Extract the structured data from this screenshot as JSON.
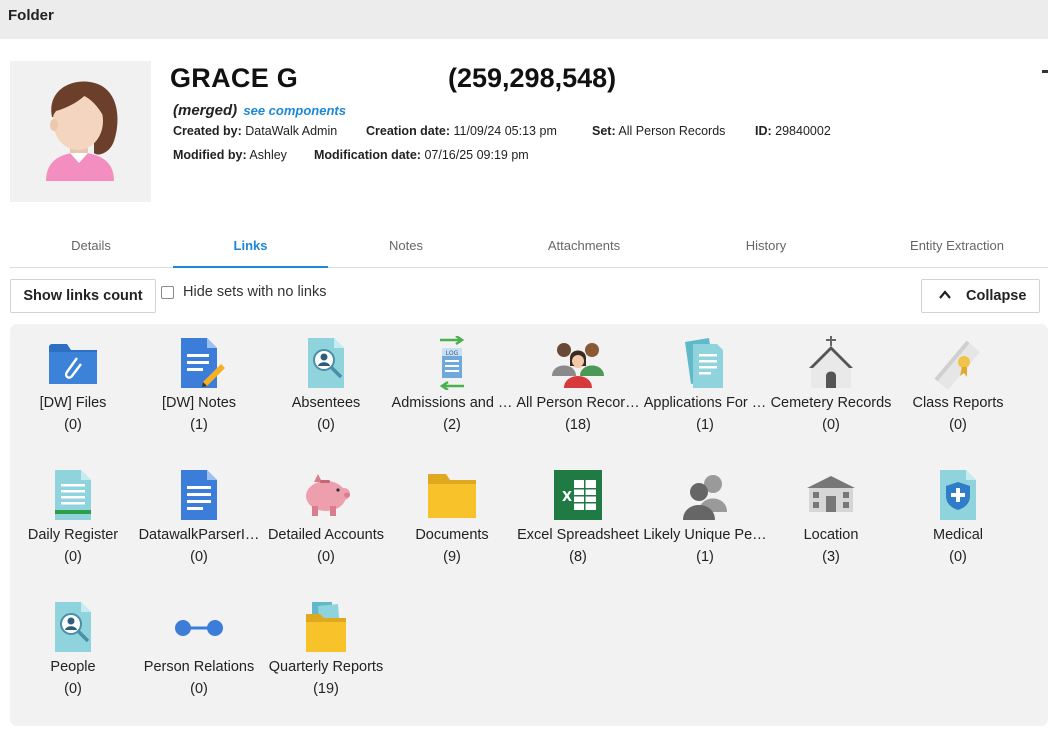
{
  "window": {
    "title": "Folder"
  },
  "record": {
    "name": "GRACE G",
    "code": "(259,298,548)",
    "merged_label": "(merged)",
    "see_components": "see components",
    "created_by_label": "Created by:",
    "created_by": "DataWalk Admin",
    "creation_date_label": "Creation date:",
    "creation_date": "11/09/24 05:13 pm",
    "set_label": "Set:",
    "set": "All Person Records",
    "id_label": "ID:",
    "id": "29840002",
    "modified_by_label": "Modified by:",
    "modified_by": "Ashley",
    "modification_date_label": "Modification date:",
    "modification_date": "07/16/25 09:19 pm"
  },
  "tabs": [
    {
      "label": "Details"
    },
    {
      "label": "Links",
      "active": true
    },
    {
      "label": "Notes"
    },
    {
      "label": "Attachments"
    },
    {
      "label": "History"
    },
    {
      "label": "Entity Extraction"
    }
  ],
  "toolbar": {
    "show_links_count": "Show links count",
    "hide_sets_label": "Hide sets with no links",
    "hide_sets_checked": false,
    "collapse": "Collapse"
  },
  "colors": {
    "accent": "#1e88d8",
    "panel": "#f2f2f2"
  },
  "sets": [
    {
      "name": "[DW] Files",
      "count": "(0)",
      "icon": "blue-folder-paperclip-icon"
    },
    {
      "name": "[DW] Notes",
      "count": "(1)",
      "icon": "document-pencil-icon"
    },
    {
      "name": "Absentees",
      "count": "(0)",
      "icon": "document-search-person-icon"
    },
    {
      "name": "Admissions and …",
      "count": "(2)",
      "icon": "log-transfer-icon"
    },
    {
      "name": "All Person Recor…",
      "count": "(18)",
      "icon": "people-group-icon"
    },
    {
      "name": "Applications For …",
      "count": "(1)",
      "icon": "stacked-documents-icon"
    },
    {
      "name": "Cemetery Records",
      "count": "(0)",
      "icon": "chapel-icon"
    },
    {
      "name": "Class Reports",
      "count": "(0)",
      "icon": "diploma-icon"
    },
    {
      "name": "Daily Register",
      "count": "(0)",
      "icon": "register-document-icon"
    },
    {
      "name": "DatawalkParserI…",
      "count": "(0)",
      "icon": "blue-document-icon"
    },
    {
      "name": "Detailed Accounts",
      "count": "(0)",
      "icon": "piggy-bank-icon"
    },
    {
      "name": "Documents",
      "count": "(9)",
      "icon": "yellow-folder-icon"
    },
    {
      "name": "Excel Spreadsheet",
      "count": "(8)",
      "icon": "excel-icon"
    },
    {
      "name": "Likely Unique Pe…",
      "count": "(1)",
      "icon": "person-silhouettes-icon"
    },
    {
      "name": "Location",
      "count": "(3)",
      "icon": "building-icon"
    },
    {
      "name": "Medical",
      "count": "(0)",
      "icon": "medical-shield-document-icon"
    },
    {
      "name": "People",
      "count": "(0)",
      "icon": "document-search-person-icon"
    },
    {
      "name": "Person Relations",
      "count": "(0)",
      "icon": "relation-link-icon"
    },
    {
      "name": "Quarterly Reports",
      "count": "(19)",
      "icon": "folder-files-icon"
    }
  ]
}
